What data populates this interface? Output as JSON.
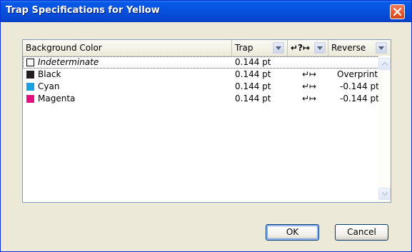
{
  "window": {
    "title": "Trap Specifications for Yellow"
  },
  "columns": {
    "background_color": "Background Color",
    "trap": "Trap",
    "direction": "↵?↦",
    "reverse": "Reverse"
  },
  "rows": [
    {
      "name": "Indeterminate",
      "trap": "0.144 pt",
      "direction": "",
      "reverse": "",
      "swatch": "#ffffff",
      "italic": true
    },
    {
      "name": "Black",
      "trap": "0.144 pt",
      "direction": "↵↦",
      "reverse": "Overprint",
      "swatch": "#231f20"
    },
    {
      "name": "Cyan",
      "trap": "0.144 pt",
      "direction": "↵↦",
      "reverse": "-0.144 pt",
      "swatch": "#1ba1e2"
    },
    {
      "name": "Magenta",
      "trap": "0.144 pt",
      "direction": "↵↦",
      "reverse": "-0.144 pt",
      "swatch": "#e2117d"
    }
  ],
  "buttons": {
    "ok": "OK",
    "cancel": "Cancel"
  },
  "icons": {
    "close": "close-icon",
    "dropdown": "chevron-down-icon",
    "scroll_up": "chevron-up-icon",
    "scroll_down": "chevron-down-icon",
    "trap_direction": "trap-direction-icon"
  },
  "colors": {
    "titlebar": "#0753e0",
    "close_button": "#d64518",
    "dialog": "#ece9d8"
  }
}
